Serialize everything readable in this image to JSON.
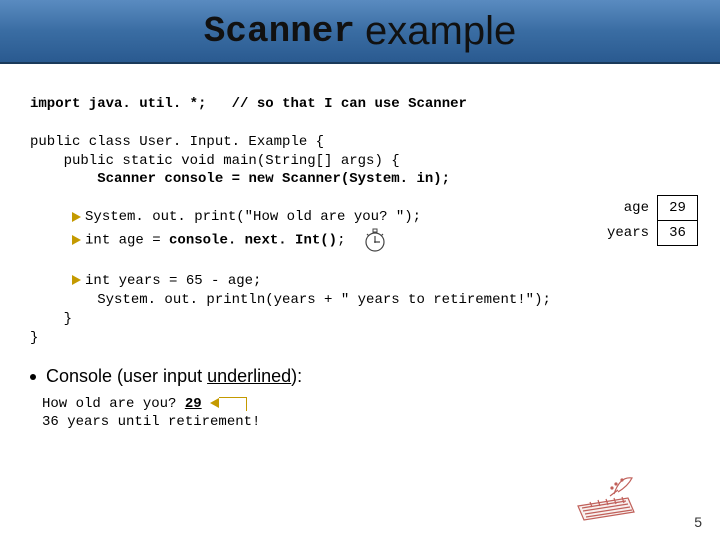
{
  "title": {
    "t1": "Scanner",
    "t2": "example"
  },
  "code": {
    "l1a": "import java. util. *;",
    "l1b": "// so that I can use Scanner",
    "l2": "public class User. Input. Example {",
    "l3": "    public static void main(String[] args) {",
    "l4a": "        ",
    "l4b": "Scanner console = new Scanner(System. in);",
    "l5": "        System. out. print(\"How old are you? \");",
    "l6a": "        int age = ",
    "l6b": "console. next. Int()",
    "l6c": ";",
    "l7": "        int years = 65 - age;",
    "l8": "        System. out. println(years + \" years to retirement!\");",
    "l9": "    }",
    "l10": "}"
  },
  "vars": {
    "label1": "age",
    "val1": "29",
    "label2": "years",
    "val2": "36"
  },
  "bullet": "Console (user input underlined):",
  "console": {
    "prompt": "How old are you? ",
    "input": "29",
    "output": "36 years until retirement!"
  },
  "page": "5"
}
